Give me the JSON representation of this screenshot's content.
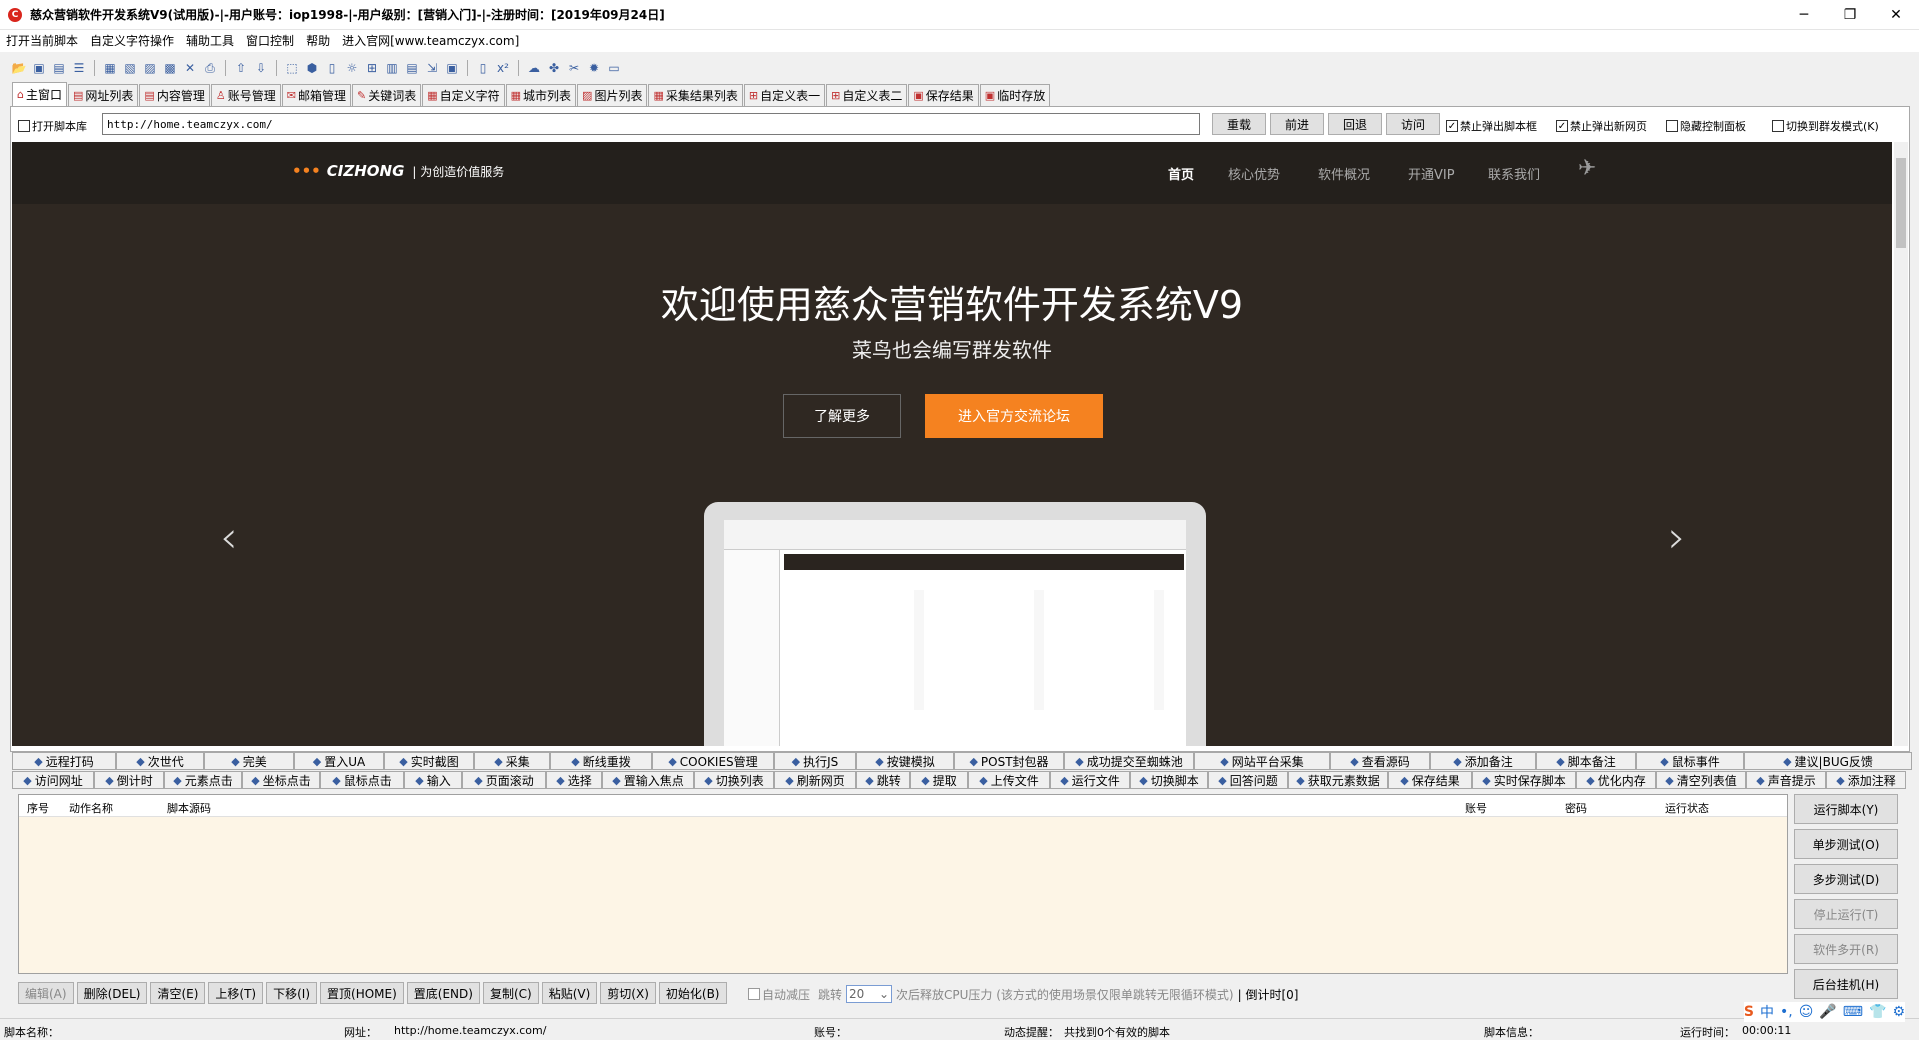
{
  "window": {
    "title": "慈众营销软件开发系统V9(试用版)-|-用户账号：iop1998-|-用户级别：[营销入门]-|-注册时间：[2019年09月24日]",
    "icon_text": "C"
  },
  "menu": [
    "打开当前脚本",
    "自定义字符操作",
    "辅助工具",
    "窗口控制",
    "帮助",
    "进入官网[www.teamczyx.com]"
  ],
  "tabs": [
    {
      "label": "主窗口",
      "icon": "home-icon"
    },
    {
      "label": "网址列表",
      "icon": "doc-icon"
    },
    {
      "label": "内容管理",
      "icon": "doc-icon"
    },
    {
      "label": "账号管理",
      "icon": "user-icon"
    },
    {
      "label": "邮箱管理",
      "icon": "mail-icon"
    },
    {
      "label": "关键词表",
      "icon": "chat-icon"
    },
    {
      "label": "自定义字符",
      "icon": "grid-icon"
    },
    {
      "label": "城市列表",
      "icon": "grid-icon"
    },
    {
      "label": "图片列表",
      "icon": "image-icon"
    },
    {
      "label": "采集结果列表",
      "icon": "grid-icon"
    },
    {
      "label": "自定义表一",
      "icon": "plus-icon"
    },
    {
      "label": "自定义表二",
      "icon": "plus-icon"
    },
    {
      "label": "保存结果",
      "icon": "save-icon"
    },
    {
      "label": "临时存放",
      "icon": "save-icon"
    }
  ],
  "address": {
    "open_lib_label": "打开脚本库",
    "url": "http://home.teamczyx.com/",
    "reload": "重载",
    "forward": "前进",
    "back": "回退",
    "visit": "访问",
    "block_popup_box": "禁止弹出脚本框",
    "block_popup_page": "禁止弹出新网页",
    "hide_panel": "隐藏控制面板",
    "group_mode": "切换到群发模式(K)"
  },
  "site": {
    "logo": "CIZHONG",
    "slogan": "| 为创造价值服务",
    "nav": [
      "首页",
      "核心优势",
      "软件概况",
      "开通VIP",
      "联系我们"
    ],
    "hero_title": "欢迎使用慈众营销软件开发系统V9",
    "hero_sub": "菜鸟也会编写群发软件",
    "btn_more": "了解更多",
    "btn_forum": "进入官方交流论坛",
    "prev": "‹",
    "next": "›"
  },
  "bottom_tabs_row1": [
    "远程打码",
    "次世代",
    "完美",
    "置入UA",
    "实时截图",
    "采集",
    "断线重拨",
    "COOKIES管理",
    "执行JS",
    "按键模拟",
    "POST封包器",
    "成功提交至蜘蛛池",
    "网站平台采集",
    "查看源码",
    "添加备注",
    "脚本备注",
    "鼠标事件",
    "建议|BUG反馈"
  ],
  "bottom_tabs_row2": [
    "访问网址",
    "倒计时",
    "元素点击",
    "坐标点击",
    "鼠标点击",
    "输入",
    "页面滚动",
    "选择",
    "置输入焦点",
    "切换列表",
    "刷新网页",
    "跳转",
    "提取",
    "上传文件",
    "运行文件",
    "切换脚本",
    "回答问题",
    "获取元素数据",
    "保存结果",
    "实时保存脚本",
    "优化内存",
    "清空列表值",
    "声音提示",
    "添加注释"
  ],
  "grid": {
    "columns": [
      "序号",
      "动作名称",
      "脚本源码",
      "账号",
      "密码",
      "运行状态"
    ]
  },
  "side_buttons": [
    {
      "label": "运行脚本(Y)",
      "disabled": false
    },
    {
      "label": "单步测试(O)",
      "disabled": false
    },
    {
      "label": "多步测试(D)",
      "disabled": false
    },
    {
      "label": "停止运行(T)",
      "disabled": true
    },
    {
      "label": "软件多开(R)",
      "disabled": true
    },
    {
      "label": "后台挂机(H)",
      "disabled": false
    }
  ],
  "actions": [
    {
      "label": "编辑(A)",
      "disabled": true
    },
    {
      "label": "删除(DEL)",
      "disabled": false
    },
    {
      "label": "清空(E)",
      "disabled": false
    },
    {
      "label": "上移(T)",
      "disabled": false
    },
    {
      "label": "下移(I)",
      "disabled": false
    },
    {
      "label": "置顶(HOME)",
      "disabled": false
    },
    {
      "label": "置底(END)",
      "disabled": false
    },
    {
      "label": "复制(C)",
      "disabled": false
    },
    {
      "label": "粘贴(V)",
      "disabled": false
    },
    {
      "label": "剪切(X)",
      "disabled": false
    },
    {
      "label": "初始化(B)",
      "disabled": false
    }
  ],
  "auto_reduce": {
    "label": "自动减压",
    "jump_label": "跳转",
    "jump_value": "20",
    "cpu_text": "次后释放CPU压力 (该方式的使用场景仅限单跳转无限循环模式)",
    "countdown": "| 倒计时[0]"
  },
  "status": {
    "script_name_label": "脚本名称：",
    "url_label": "网址：",
    "url_value": "http://home.teamczyx.com/",
    "account_label": "账号：",
    "dynamic_label": "动态提醒：",
    "dynamic_value": "共找到0个有效的脚本",
    "script_info_label": "脚本信息：",
    "runtime_label": "运行时间：",
    "runtime_value": "00:00:11"
  },
  "ime": [
    "S",
    "中",
    "•,",
    "☺",
    "🎤",
    "⌨",
    "👕",
    "⚙"
  ]
}
